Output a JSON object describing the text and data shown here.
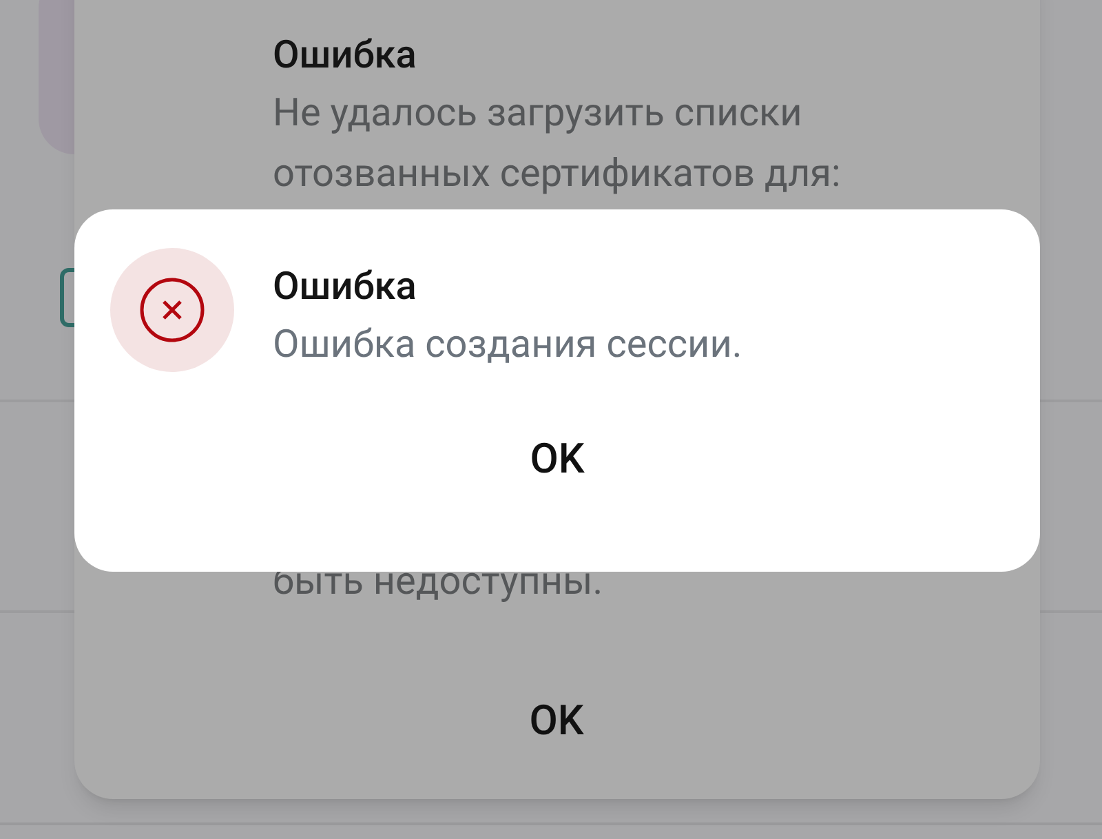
{
  "background_dialog": {
    "title": "Ошибка",
    "message_lines": [
      "Не удалось загрузить списки",
      "отозванных сертификатов для:"
    ],
    "last_line": "быть недоступны.",
    "button": "OK"
  },
  "front_dialog": {
    "title": "Ошибка",
    "message": "Ошибка создания сессии.",
    "button": "OK"
  }
}
